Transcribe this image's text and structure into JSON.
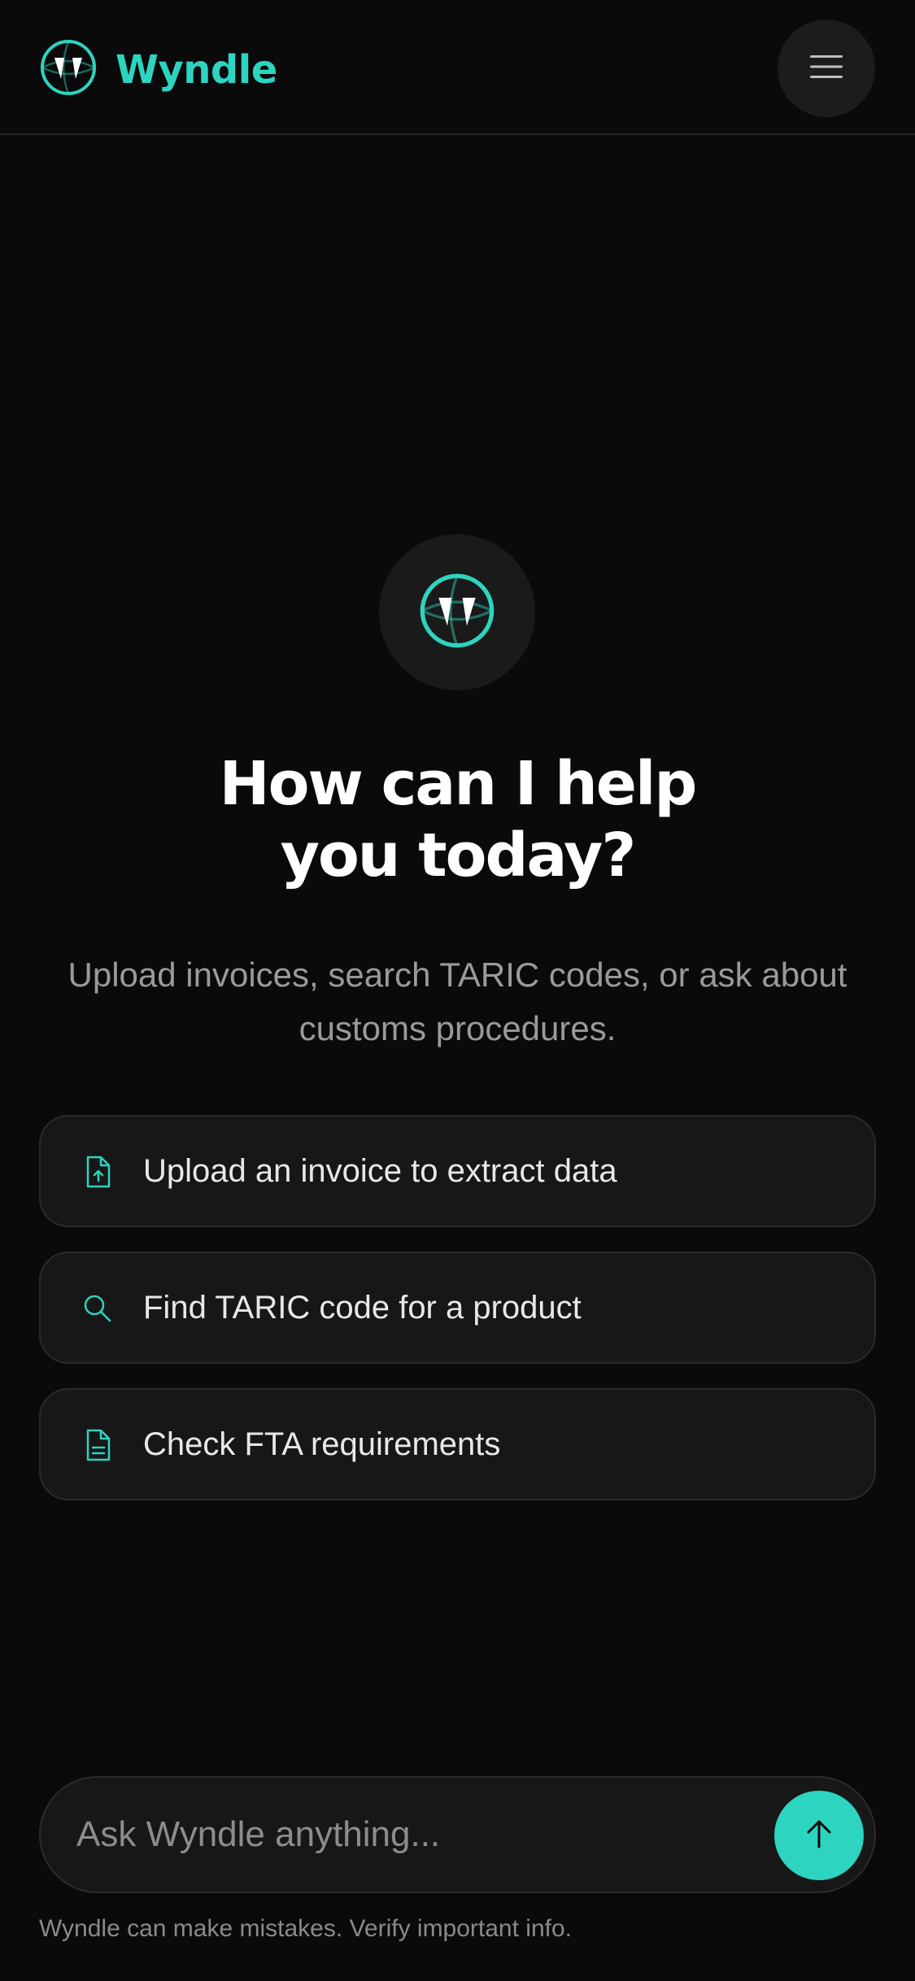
{
  "header": {
    "brand_name": "Wyndle",
    "logo_icon": "wyndle-logo-icon",
    "menu_icon": "hamburger-menu-icon"
  },
  "hero": {
    "icon": "wyndle-logo-icon",
    "title_line1": "How can I help",
    "title_line2": "you today?",
    "subtitle": "Upload invoices, search TARIC codes, or ask about customs procedures."
  },
  "suggestions": [
    {
      "icon": "file-upload-icon",
      "label": "Upload an invoice to extract data"
    },
    {
      "icon": "search-icon",
      "label": "Find TARIC code for a product"
    },
    {
      "icon": "document-text-icon",
      "label": "Check FTA requirements"
    }
  ],
  "composer": {
    "placeholder": "Ask Wyndle anything...",
    "value": "",
    "send_icon": "arrow-up-icon",
    "disclaimer": "Wyndle can make mistakes. Verify important info."
  },
  "colors": {
    "accent": "#2dd4bf",
    "background": "#0a0a0a",
    "card": "#171717",
    "border": "#2a2a2a"
  }
}
